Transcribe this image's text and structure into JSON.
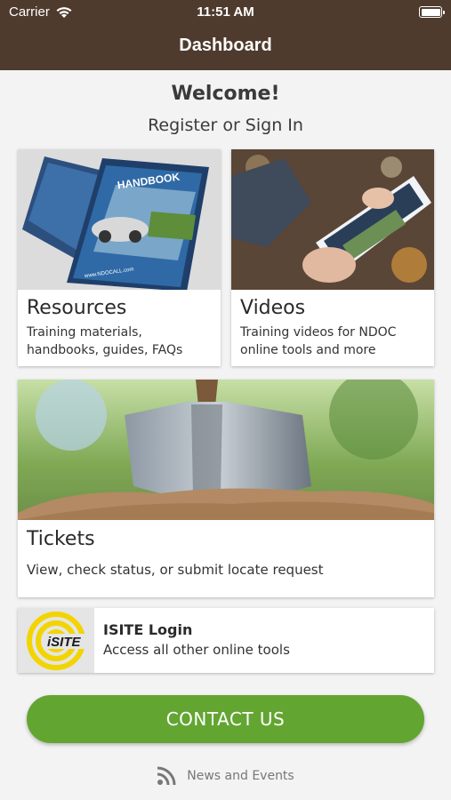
{
  "status_bar": {
    "carrier": "Carrier",
    "time": "11:51 AM"
  },
  "nav": {
    "title": "Dashboard"
  },
  "intro": {
    "welcome": "Welcome!",
    "register": "Register or Sign In"
  },
  "cards": {
    "resources": {
      "title": "Resources",
      "description": "Training materials, handbooks, guides, FAQs"
    },
    "videos": {
      "title": "Videos",
      "description": "Training videos for NDOC online tools and more"
    },
    "tickets": {
      "title": "Tickets",
      "description": "View, check status, or submit locate request"
    },
    "isite": {
      "title": "ISITE Login",
      "description": "Access all other online tools",
      "logo_text": "iSITE"
    }
  },
  "resources_image": {
    "handbook_text": "HANDBOOK",
    "url_text": "www.NDOCALL.com"
  },
  "contact": {
    "label": "CONTACT US"
  },
  "news": {
    "label": "News and Events"
  },
  "colors": {
    "header": "#4e3b2d",
    "accent": "#63a531",
    "isite_yellow": "#f2d400"
  }
}
